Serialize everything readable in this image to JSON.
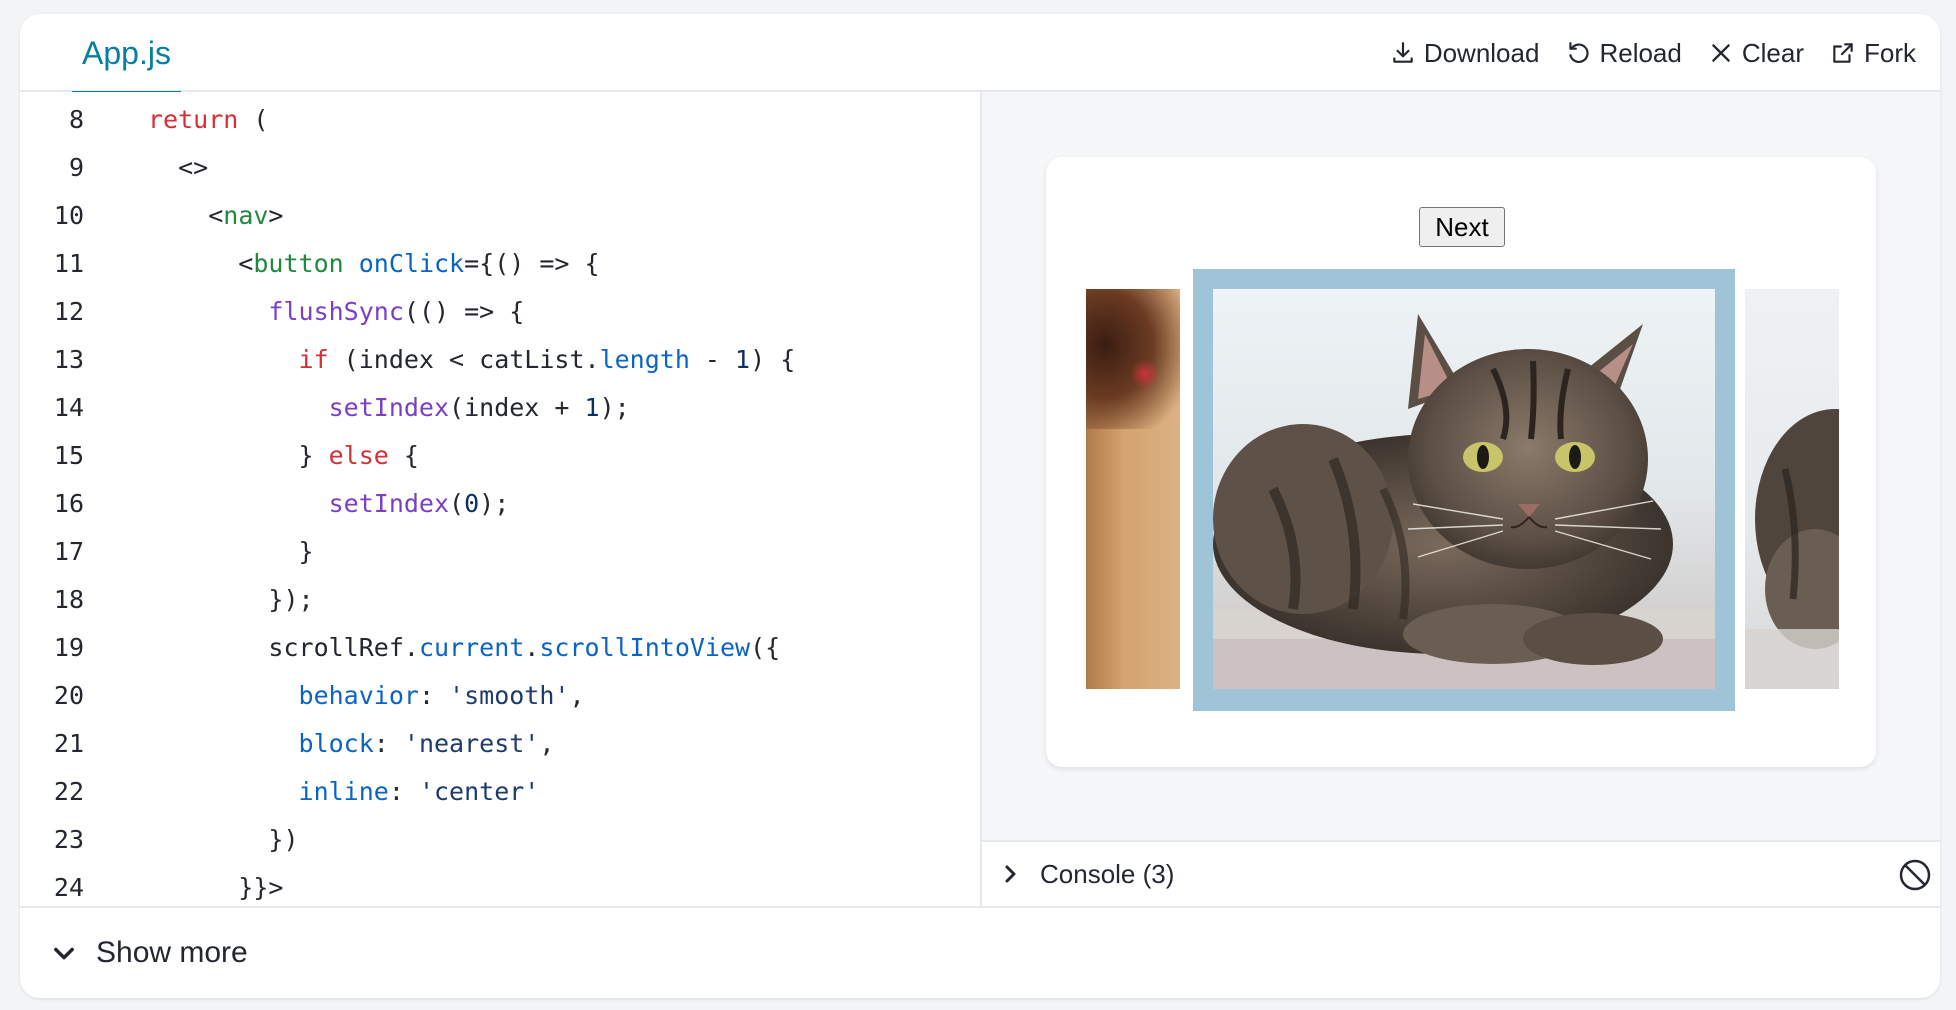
{
  "tabs": {
    "active_file": "App.js"
  },
  "toolbar": {
    "download_label": "Download",
    "reload_label": "Reload",
    "clear_label": "Clear",
    "fork_label": "Fork"
  },
  "editor": {
    "lines": [
      {
        "n": "8"
      },
      {
        "n": "9"
      },
      {
        "n": "10"
      },
      {
        "n": "11"
      },
      {
        "n": "12"
      },
      {
        "n": "13"
      },
      {
        "n": "14"
      },
      {
        "n": "15"
      },
      {
        "n": "16"
      },
      {
        "n": "17"
      },
      {
        "n": "18"
      },
      {
        "n": "19"
      },
      {
        "n": "20"
      },
      {
        "n": "21"
      },
      {
        "n": "22"
      },
      {
        "n": "23"
      },
      {
        "n": "24"
      }
    ]
  },
  "preview": {
    "next_label": "Next"
  },
  "console": {
    "label": "Console (3)"
  },
  "footer": {
    "show_more_label": "Show more"
  }
}
